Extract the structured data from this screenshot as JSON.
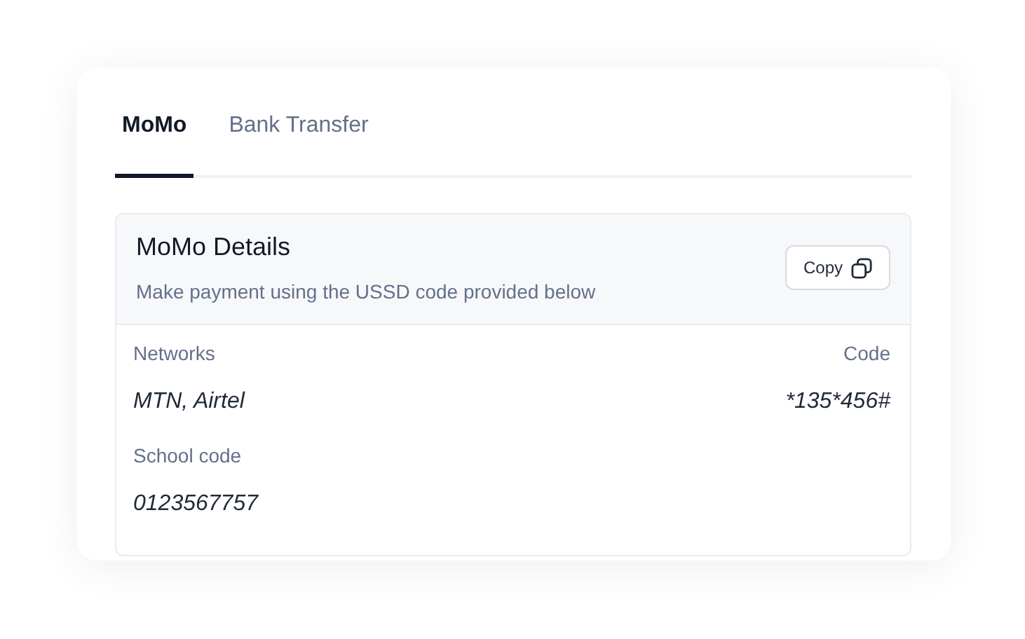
{
  "tabs": [
    {
      "label": "MoMo",
      "selected": true
    },
    {
      "label": "Bank Transfer",
      "selected": false
    }
  ],
  "details": {
    "title": "MoMo Details",
    "subtitle": "Make payment using the USSD code provided below",
    "copy_button": "Copy",
    "fields": [
      {
        "label": "Networks",
        "value": "MTN, Airtel",
        "label_2": "Code",
        "value_2": "*135*456#"
      },
      {
        "label": "School code",
        "value": "0123567757"
      }
    ]
  }
}
